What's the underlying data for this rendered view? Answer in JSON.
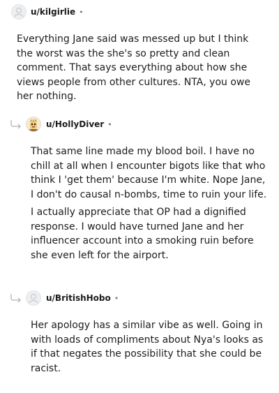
{
  "comments": [
    {
      "username": "u/kilgirlie",
      "separator": "•",
      "paragraphs": [
        "Everything Jane said was messed up but I think the worst was the she's so pretty and clean comment. That says everything about how she views people from other cultures. NTA, you owe her nothing."
      ]
    },
    {
      "username": "u/HollyDiver",
      "separator": "•",
      "paragraphs": [
        "That same line made my blood boil. I have no chill at all when I encounter bigots like that who think I 'get them' because I'm white. Nope Jane, I don't do causal n-bombs, time to ruin your life.",
        "I actually appreciate that OP had a dignified response. I would have turned Jane and her influencer account into a smoking ruin before she even left for the airport."
      ]
    },
    {
      "username": "u/BritishHobo",
      "separator": "•",
      "paragraphs": [
        "Her apology has a similar vibe as well. Going in with loads of compliments about Nya's looks as if that negates the possibility that she could be racist."
      ]
    }
  ]
}
